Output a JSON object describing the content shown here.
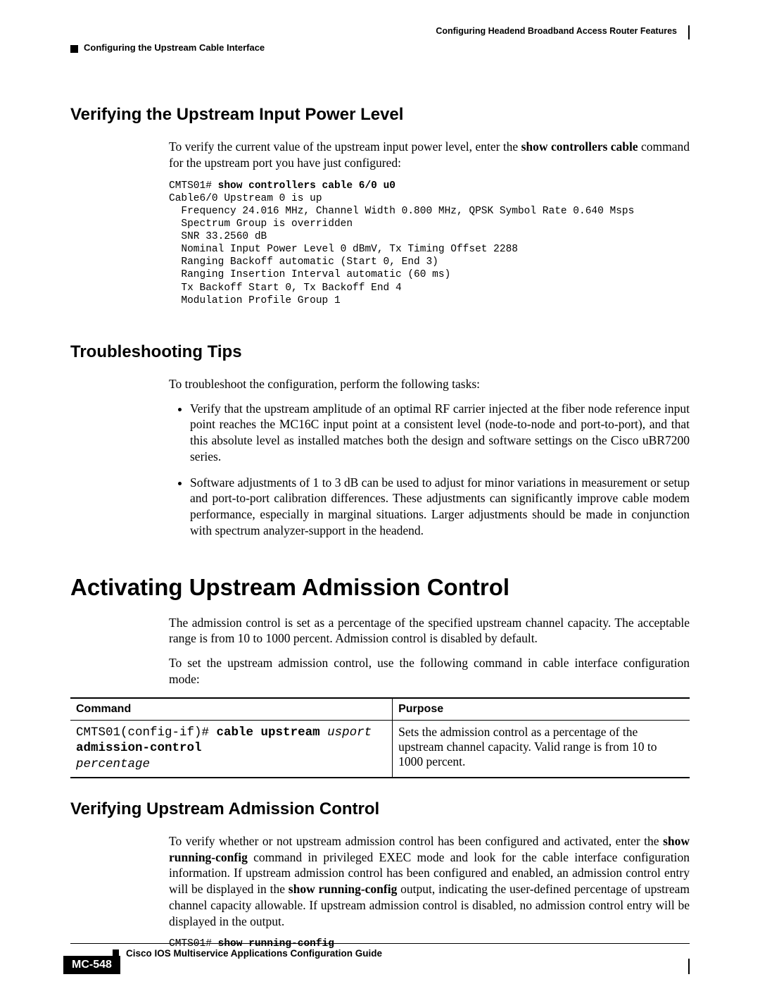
{
  "header": {
    "right": "Configuring Headend Broadband Access Router Features",
    "left": "Configuring the Upstream Cable Interface"
  },
  "s1": {
    "heading": "Verifying the Upstream Input Power Level",
    "p1_a": "To verify the current value of the upstream input power level, enter the ",
    "p1_b": "show controllers cable",
    "p1_c": " command for the upstream port you have just configured:",
    "code_prompt": "CMTS01# ",
    "code_cmd": "show controllers cable 6/0 u0",
    "code_body": "Cable6/0 Upstream 0 is up\n  Frequency 24.016 MHz, Channel Width 0.800 MHz, QPSK Symbol Rate 0.640 Msps\n  Spectrum Group is overridden\n  SNR 33.2560 dB\n  Nominal Input Power Level 0 dBmV, Tx Timing Offset 2288\n  Ranging Backoff automatic (Start 0, End 3)\n  Ranging Insertion Interval automatic (60 ms)\n  Tx Backoff Start 0, Tx Backoff End 4\n  Modulation Profile Group 1"
  },
  "s2": {
    "heading": "Troubleshooting Tips",
    "p1": "To troubleshoot the configuration, perform the following tasks:",
    "b1": "Verify that the upstream amplitude of an optimal RF carrier injected at the fiber node reference input point reaches the MC16C input point at a consistent level (node-to-node and port-to-port), and that this absolute level as installed matches both the design and software settings on the Cisco uBR7200 series.",
    "b2": "Software adjustments of 1 to 3 dB can be used to adjust for minor variations in measurement or setup and port-to-port calibration differences. These adjustments can significantly improve cable modem performance, especially in marginal situations. Larger adjustments should be made in conjunction with spectrum analyzer-support in the headend."
  },
  "s3": {
    "heading": "Activating Upstream Admission Control",
    "p1": "The admission control is set as a percentage of the specified upstream channel capacity. The acceptable range is from 10 to 1000 percent. Admission control is disabled by default.",
    "p2": "To set the upstream admission control, use the following command in cable interface configuration mode:",
    "th1": "Command",
    "th2": "Purpose",
    "cmd_prompt": "CMTS01(config-if)# ",
    "cmd_b1": "cable upstream",
    "cmd_i1": " usport ",
    "cmd_b2": "admission-control",
    "cmd_i2": "percentage",
    "purpose": "Sets the admission control as a percentage of the upstream channel capacity. Valid range is from 10 to 1000 percent."
  },
  "s4": {
    "heading": "Verifying Upstream Admission Control",
    "p1_a": "To verify whether or not upstream admission control has been configured and activated, enter the ",
    "p1_b": "show running-config",
    "p1_c": " command in privileged EXEC mode and look for the cable interface configuration information. If upstream admission control has been configured and enabled, an admission control entry will be displayed in the ",
    "p1_d": "show running-config",
    "p1_e": " output, indicating the user-defined percentage of upstream channel capacity allowable. If upstream admission control is disabled, no admission control entry will be displayed in the output.",
    "code_prompt": "CMTS01# ",
    "code_cmd": "show running-config"
  },
  "footer": {
    "title": "Cisco IOS Multiservice Applications Configuration Guide",
    "page": "MC-548"
  }
}
